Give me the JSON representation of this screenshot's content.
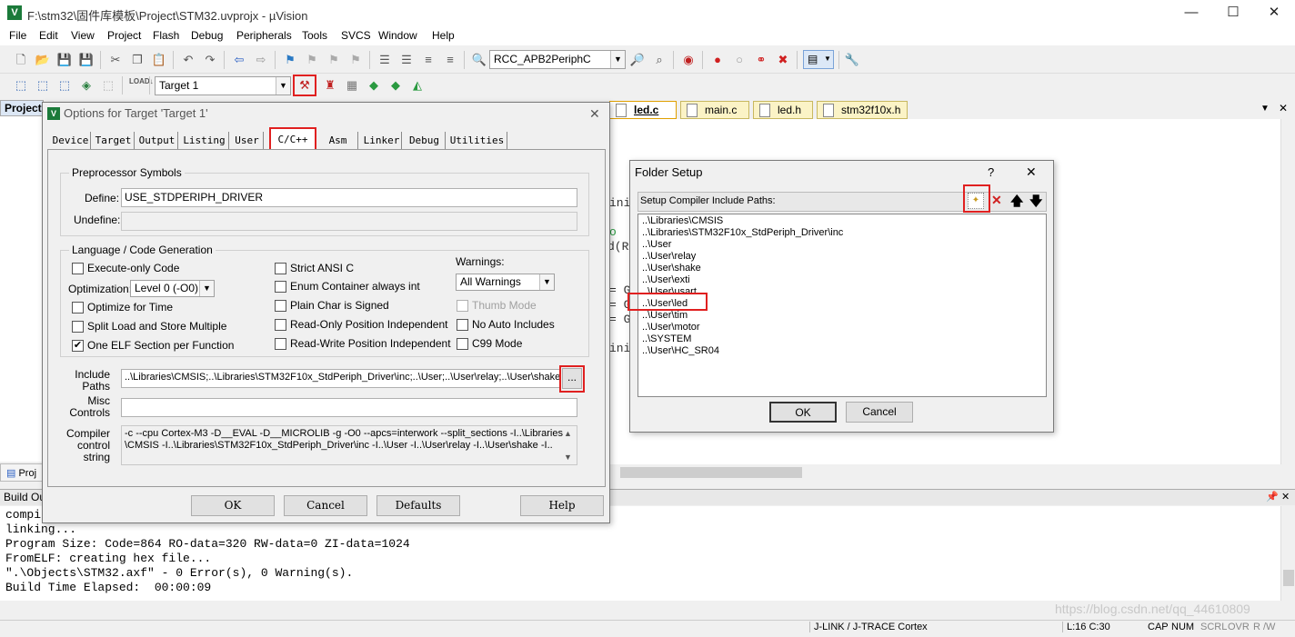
{
  "window": {
    "title": "F:\\stm32\\固件库模板\\Project\\STM32.uvprojx - µVision",
    "minimize": "—",
    "maximize": "☐",
    "close": "✕"
  },
  "menu": [
    "File",
    "Edit",
    "View",
    "Project",
    "Flash",
    "Debug",
    "Peripherals",
    "Tools",
    "SVCS",
    "Window",
    "Help"
  ],
  "toolbar": {
    "find_combo": "RCC_APB2PeriphC",
    "target_combo": "Target 1"
  },
  "project_pane": {
    "tab": "Project",
    "bottom_tab": "Proj"
  },
  "editor": {
    "tabs": [
      {
        "label": "led.c",
        "active": true
      },
      {
        "label": "main.c",
        "active": false
      },
      {
        "label": "led.h",
        "active": false
      },
      {
        "label": "stm32f10x.h",
        "active": false
      }
    ],
    "code_fragments": [
      "ini",
      "o",
      "d(R",
      "= G",
      "= G",
      "= G",
      "ini"
    ]
  },
  "build_output": {
    "title": "Build Ou",
    "lines": [
      "compi",
      "linking...",
      "Program Size: Code=864 RO-data=320 RW-data=0 ZI-data=1024",
      "FromELF: creating hex file...",
      "\".\\Objects\\STM32.axf\" - 0 Error(s), 0 Warning(s).",
      "Build Time Elapsed:  00:00:09"
    ]
  },
  "statusbar": {
    "debugger": "J-LINK / J-TRACE Cortex",
    "position": "L:16 C:30",
    "caps": "CAP",
    "num": "NUM",
    "scrl": "SCRL",
    "ovr": "OVR",
    "rw": "R /W",
    "watermark": "https://blog.csdn.net/qq_44610809"
  },
  "options_dialog": {
    "title": "Options for Target 'Target 1'",
    "close": "✕",
    "tabs": [
      "Device",
      "Target",
      "Output",
      "Listing",
      "User",
      "C/C++",
      "Asm",
      "Linker",
      "Debug",
      "Utilities"
    ],
    "active_tab": "C/C++",
    "preprocessor": {
      "group_title": "Preprocessor Symbols",
      "define_label": "Define:",
      "define_value": "USE_STDPERIPH_DRIVER",
      "undefine_label": "Undefine:",
      "undefine_value": ""
    },
    "language": {
      "group_title": "Language / Code Generation",
      "execute_only": {
        "label": "Execute-only Code",
        "checked": false
      },
      "optimization_label": "Optimization:",
      "optimization_value": "Level 0 (-O0)",
      "optimize_time": {
        "label": "Optimize for Time",
        "checked": false
      },
      "split_load": {
        "label": "Split Load and Store Multiple",
        "checked": false
      },
      "one_elf": {
        "label": "One ELF Section per Function",
        "checked": true
      },
      "strict_ansi": {
        "label": "Strict ANSI C",
        "checked": false
      },
      "enum_container": {
        "label": "Enum Container always int",
        "checked": false
      },
      "plain_char": {
        "label": "Plain Char is Signed",
        "checked": false
      },
      "ro_pos": {
        "label": "Read-Only Position Independent",
        "checked": false
      },
      "rw_pos": {
        "label": "Read-Write Position Independent",
        "checked": false
      },
      "warnings_label": "Warnings:",
      "warnings_value": "All Warnings",
      "thumb_mode": {
        "label": "Thumb Mode",
        "checked": false
      },
      "no_auto_includes": {
        "label": "No Auto Includes",
        "checked": false
      },
      "c99_mode": {
        "label": "C99 Mode",
        "checked": false
      }
    },
    "include_label": "Include\nPaths",
    "include_value": "..\\Libraries\\CMSIS;..\\Libraries\\STM32F10x_StdPeriph_Driver\\inc;..\\User;..\\User\\relay;..\\User\\shake",
    "browse_button": "...",
    "misc_label": "Misc\nControls",
    "misc_value": "",
    "compiler_label": "Compiler\ncontrol\nstring",
    "compiler_line1": "-c --cpu Cortex-M3 -D__EVAL -D__MICROLIB -g -O0 --apcs=interwork --split_sections -I..\\Libraries",
    "compiler_line2": "\\CMSIS -I..\\Libraries\\STM32F10x_StdPeriph_Driver\\inc -I..\\User -I..\\User\\relay -I..\\User\\shake -I..",
    "buttons": {
      "ok": "OK",
      "cancel": "Cancel",
      "defaults": "Defaults",
      "help": "Help"
    }
  },
  "folder_dialog": {
    "title": "Folder Setup",
    "help": "?",
    "close": "✕",
    "header_label": "Setup Compiler Include Paths:",
    "paths": [
      "..\\Libraries\\CMSIS",
      "..\\Libraries\\STM32F10x_StdPeriph_Driver\\inc",
      "..\\User",
      "..\\User\\relay",
      "..\\User\\shake",
      "..\\User\\exti",
      "..\\User\\usart",
      "..\\User\\led",
      "..\\User\\tim",
      "..\\User\\motor",
      "..\\SYSTEM",
      "..\\User\\HC_SR04"
    ],
    "highlighted_path": "..\\User\\led",
    "ok": "OK",
    "cancel": "Cancel"
  }
}
